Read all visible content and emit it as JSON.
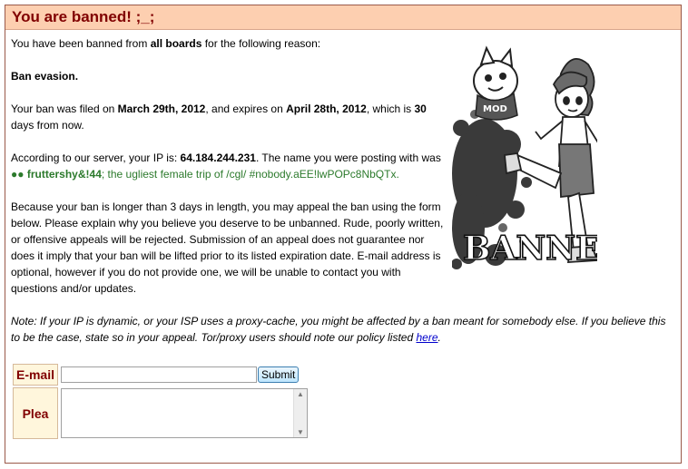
{
  "header": {
    "title": "You are banned! ;_;"
  },
  "message": {
    "p1_pre": "You have been banned from ",
    "p1_bold": "all boards",
    "p1_post": " for the following reason:",
    "reason": "Ban evasion.",
    "p3_pre": "Your ban was filed on ",
    "filed_date": "March 29th, 2012",
    "p3_mid": ", and expires on ",
    "expires_date": "April 28th, 2012",
    "p3_mid2": ", which is ",
    "days": "30",
    "p3_post": " days from now.",
    "p4_pre": "According to our server, your IP is: ",
    "ip": "64.184.244.231",
    "p4_post": ". The name you were posting with was",
    "trip_icon": "●●",
    "trip_name": "fruttershy&!44",
    "trip_rest": "; the ugliest female trip of /cgl/ #nobody.aEE!lwPOPc8NbQTx.",
    "p5": "Because your ban is longer than 3 days in length, you may appeal the ban using the form below. Please explain why you believe you deserve to be unbanned. Rude, poorly written, or offensive appeals will be rejected. Submission of an appeal does not guarantee nor does it imply that your ban will be lifted prior to its listed expiration date. E-mail address is optional, however if you do not provide one, we will be unable to contact you with questions and/or updates."
  },
  "note": {
    "text": "Note: If your IP is dynamic, or your ISP uses a proxy-cache, you might be affected by a ban meant for somebody else. If you believe this to be the case, state so in your appeal. Tor/proxy users should note our policy listed ",
    "link": "here",
    "end": "."
  },
  "illustration": {
    "stamp_text": "BANNED",
    "badge_text": "MOD"
  },
  "form": {
    "email_label": "E-mail",
    "email_value": "",
    "submit_label": "Submit",
    "plea_label": "Plea",
    "plea_value": ""
  }
}
